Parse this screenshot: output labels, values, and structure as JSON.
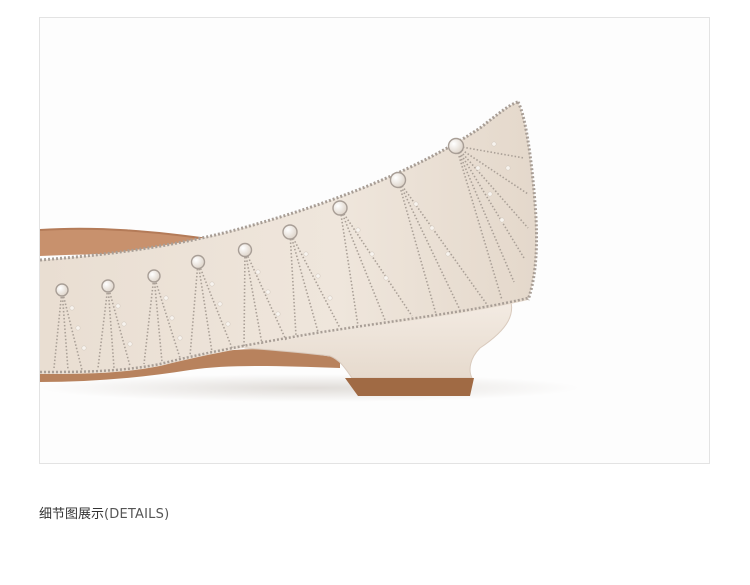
{
  "photo": {
    "subject": "shoe-detail-photo",
    "colors": {
      "background": "#fdfdfd",
      "upper": "#ece2d7",
      "lining": "#c8916d",
      "heel": "#f1e8e0",
      "heel_tip": "#a06a44",
      "rhinestone": "#a89e96",
      "pearl": "#f7f3ee"
    }
  },
  "caption": {
    "title": "细节图展示",
    "subtitle": "(DETAILS)"
  }
}
